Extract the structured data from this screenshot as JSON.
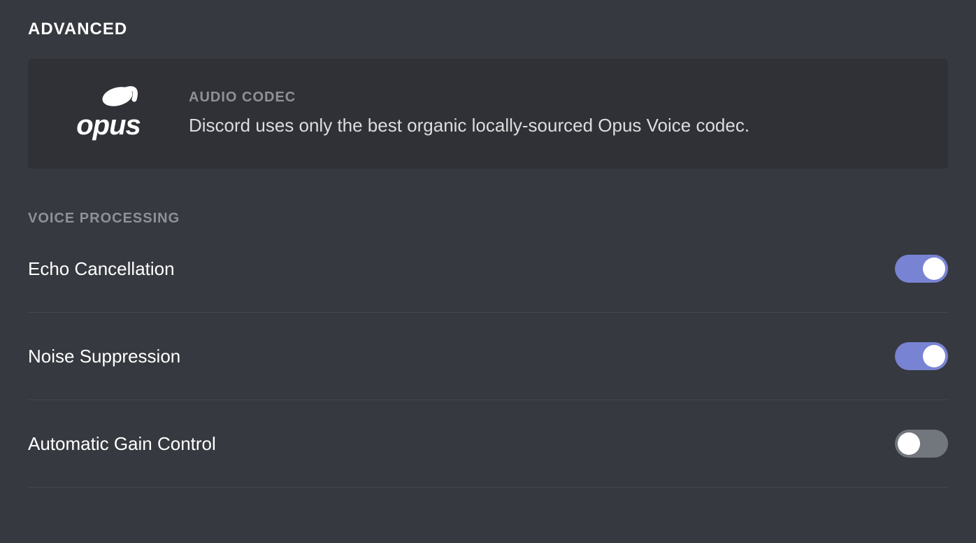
{
  "section": {
    "title": "ADVANCED"
  },
  "codec": {
    "label": "AUDIO CODEC",
    "description": "Discord uses only the best organic locally-sourced Opus Voice codec.",
    "logo_name": "opus"
  },
  "voice_processing": {
    "title": "VOICE PROCESSING",
    "settings": [
      {
        "label": "Echo Cancellation",
        "enabled": true
      },
      {
        "label": "Noise Suppression",
        "enabled": true
      },
      {
        "label": "Automatic Gain Control",
        "enabled": false
      }
    ]
  }
}
